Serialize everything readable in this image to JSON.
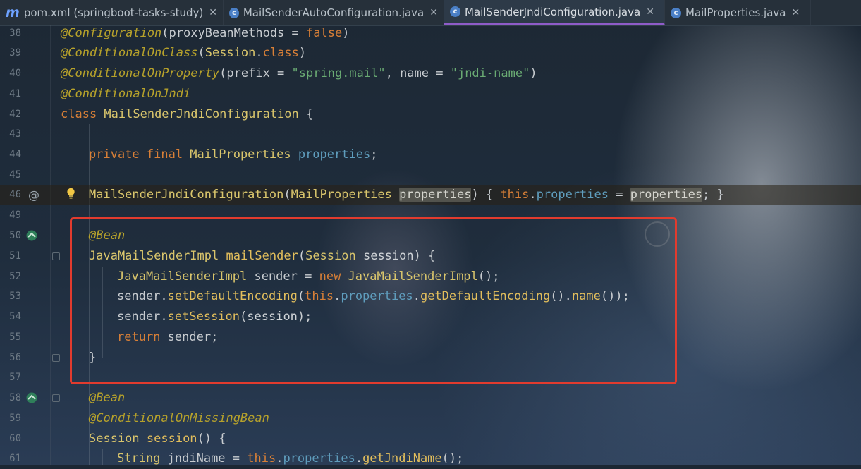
{
  "tabs": [
    {
      "label": "pom.xml (springboot-tasks-study)",
      "icon": "m",
      "active": false
    },
    {
      "label": "MailSenderAutoConfiguration.java",
      "icon": "c",
      "active": false
    },
    {
      "label": "MailSenderJndiConfiguration.java",
      "icon": "c",
      "active": true
    },
    {
      "label": "MailProperties.java",
      "icon": "c",
      "active": false
    }
  ],
  "tab_close_glyph": "✕",
  "gutter": {
    "at_symbol": "@",
    "icons": [
      "bulb-icon",
      "bean-icon",
      "at-icon",
      "fold-icon"
    ]
  },
  "code": {
    "l38": {
      "n": "38",
      "a": "@Configuration",
      "b": "(proxyBeanMethods = ",
      "c": "false",
      "d": ")"
    },
    "l39": {
      "n": "39",
      "a": "@ConditionalOnClass",
      "b": "(",
      "c": "Session",
      "d": ".",
      "e": "class",
      "f": ")"
    },
    "l40": {
      "n": "40",
      "a": "@ConditionalOnProperty",
      "b": "(prefix = ",
      "c": "\"spring.mail\"",
      "d": ", name = ",
      "e": "\"jndi-name\"",
      "f": ")"
    },
    "l41": {
      "n": "41",
      "a": "@ConditionalOnJndi"
    },
    "l42": {
      "n": "42",
      "a": "class ",
      "b": "MailSenderJndiConfiguration",
      "c": " {"
    },
    "l43": {
      "n": "43"
    },
    "l44": {
      "n": "44",
      "a": "private final ",
      "b": "MailProperties ",
      "c": "properties",
      "d": ";"
    },
    "l45": {
      "n": "45"
    },
    "l46": {
      "n": "46",
      "a": "MailSenderJndiConfiguration",
      "b": "(",
      "c": "MailProperties ",
      "d": "properties",
      "e": ") { ",
      "f": "this",
      "g": ".",
      "h": "properties",
      "i": " = ",
      "j": "properties",
      "k": "; }"
    },
    "l49": {
      "n": "49"
    },
    "l50": {
      "n": "50",
      "a": "@Bean"
    },
    "l51": {
      "n": "51",
      "a": "JavaMailSenderImpl ",
      "b": "mailSender",
      "c": "(",
      "d": "Session ",
      "e": "session",
      "f": ") {"
    },
    "l52": {
      "n": "52",
      "a": "JavaMailSenderImpl ",
      "b": "sender = ",
      "c": "new ",
      "d": "JavaMailSenderImpl",
      "e": "();"
    },
    "l53": {
      "n": "53",
      "a": "sender.",
      "b": "setDefaultEncoding",
      "c": "(",
      "d": "this",
      "e": ".",
      "f": "properties",
      "g": ".",
      "h": "getDefaultEncoding",
      "i": "().",
      "j": "name",
      "k": "());"
    },
    "l54": {
      "n": "54",
      "a": "sender.",
      "b": "setSession",
      "c": "(",
      "d": "session",
      "e": ");"
    },
    "l55": {
      "n": "55",
      "a": "return ",
      "b": "sender;"
    },
    "l56": {
      "n": "56",
      "a": "}"
    },
    "l57": {
      "n": "57"
    },
    "l58": {
      "n": "58",
      "a": "@Bean"
    },
    "l59": {
      "n": "59",
      "a": "@ConditionalOnMissingBean"
    },
    "l60": {
      "n": "60",
      "a": "Session ",
      "b": "session",
      "c": "() {"
    },
    "l61": {
      "n": "61",
      "a": "String ",
      "b": "jndiName = ",
      "c": "this",
      "d": ".",
      "e": "properties",
      "f": ".",
      "g": "getJndiName",
      "h": "();"
    }
  },
  "colors": {
    "highlight_box": "#e23b2e",
    "active_tab_underline": "#8f5cc9",
    "annotation": "#b7a22b",
    "keyword": "#d77f37",
    "string": "#6aab73",
    "field": "#5f9dbd"
  }
}
